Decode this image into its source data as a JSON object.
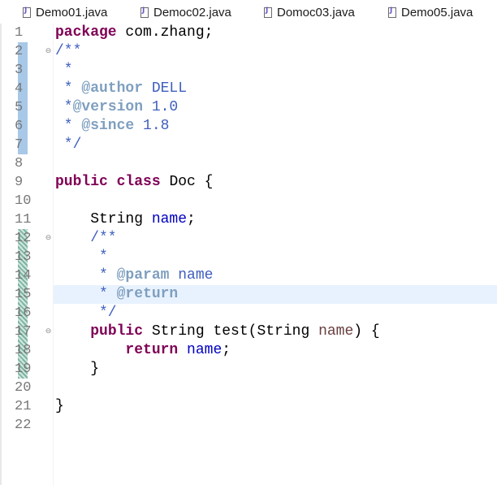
{
  "tabs": [
    {
      "label": "Demo01.java"
    },
    {
      "label": "Democ02.java"
    },
    {
      "label": "Domoc03.java"
    },
    {
      "label": "Demo05.java"
    }
  ],
  "editor": {
    "colors": {
      "keyword": "#7f0055",
      "javadoc": "#3f5fbf",
      "javadoc_tag": "#7f9fbf",
      "field": "#0000c0",
      "parameter": "#6a3e3e",
      "current_line": "#e8f2fe",
      "line_number": "#787878"
    },
    "lines": [
      {
        "num": "1",
        "segments": [
          [
            "kw",
            "package"
          ],
          [
            "txt",
            " com.zhang;"
          ]
        ]
      },
      {
        "num": "2",
        "fold": "⊖",
        "segments": [
          [
            "cm",
            "/**"
          ]
        ]
      },
      {
        "num": "3",
        "segments": [
          [
            "cm",
            " *"
          ]
        ]
      },
      {
        "num": "4",
        "segments": [
          [
            "cm",
            " * "
          ],
          [
            "tag",
            "@author"
          ],
          [
            "cm",
            " DELL"
          ]
        ]
      },
      {
        "num": "5",
        "segments": [
          [
            "cm",
            " *"
          ],
          [
            "tag",
            "@version"
          ],
          [
            "cm",
            " 1.0"
          ]
        ]
      },
      {
        "num": "6",
        "segments": [
          [
            "cm",
            " * "
          ],
          [
            "tag",
            "@since"
          ],
          [
            "cm",
            " 1.8"
          ]
        ]
      },
      {
        "num": "7",
        "segments": [
          [
            "cm",
            " */"
          ]
        ]
      },
      {
        "num": "8",
        "segments": []
      },
      {
        "num": "9",
        "segments": [
          [
            "kw",
            "public"
          ],
          [
            "txt",
            " "
          ],
          [
            "kw",
            "class"
          ],
          [
            "txt",
            " Doc {"
          ]
        ]
      },
      {
        "num": "10",
        "segments": []
      },
      {
        "num": "11",
        "segments": [
          [
            "txt",
            "    String "
          ],
          [
            "fld",
            "name"
          ],
          [
            "txt",
            ";"
          ]
        ]
      },
      {
        "num": "12",
        "fold": "⊖",
        "segments": [
          [
            "cm",
            "    /**"
          ]
        ]
      },
      {
        "num": "13",
        "segments": [
          [
            "cm",
            "     *"
          ]
        ]
      },
      {
        "num": "14",
        "segments": [
          [
            "cm",
            "     * "
          ],
          [
            "tag",
            "@param"
          ],
          [
            "cm",
            " name"
          ]
        ]
      },
      {
        "num": "15",
        "current": true,
        "segments": [
          [
            "cm",
            "     * "
          ],
          [
            "tag",
            "@return"
          ]
        ]
      },
      {
        "num": "16",
        "segments": [
          [
            "cm",
            "     */"
          ]
        ]
      },
      {
        "num": "17",
        "fold": "⊖",
        "segments": [
          [
            "txt",
            "    "
          ],
          [
            "kw",
            "public"
          ],
          [
            "txt",
            " String test(String "
          ],
          [
            "prm",
            "name"
          ],
          [
            "txt",
            ") {"
          ]
        ]
      },
      {
        "num": "18",
        "segments": [
          [
            "txt",
            "        "
          ],
          [
            "kw",
            "return"
          ],
          [
            "txt",
            " "
          ],
          [
            "fld",
            "name"
          ],
          [
            "txt",
            ";"
          ]
        ]
      },
      {
        "num": "19",
        "segments": [
          [
            "txt",
            "    }"
          ]
        ]
      },
      {
        "num": "20",
        "segments": []
      },
      {
        "num": "21",
        "segments": [
          [
            "txt",
            "}"
          ]
        ]
      },
      {
        "num": "22",
        "segments": []
      }
    ]
  }
}
